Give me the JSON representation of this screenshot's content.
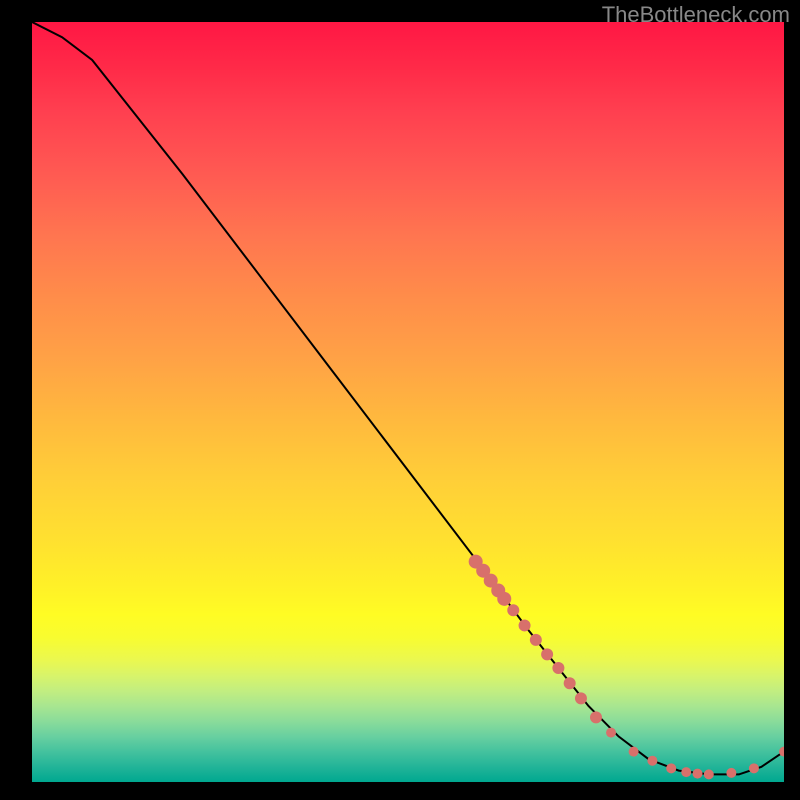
{
  "attribution": "TheBottleneck.com",
  "chart_data": {
    "type": "line",
    "title": "",
    "xlabel": "",
    "ylabel": "",
    "xlim": [
      0,
      100
    ],
    "ylim": [
      0,
      100
    ],
    "background_gradient": {
      "orientation": "vertical",
      "stops": [
        {
          "pos": 0,
          "color": "#ff1744"
        },
        {
          "pos": 50,
          "color": "#ffc040"
        },
        {
          "pos": 78,
          "color": "#fffc24"
        },
        {
          "pos": 100,
          "color": "#00a890"
        }
      ]
    },
    "series": [
      {
        "name": "curve",
        "stroke": "#000000",
        "x": [
          0,
          4,
          8,
          12,
          20,
          30,
          40,
          50,
          60,
          66,
          70,
          74,
          78,
          82,
          86,
          90,
          94,
          97,
          100
        ],
        "y": [
          100,
          98,
          95,
          90,
          80,
          67,
          54,
          41,
          28,
          20,
          15,
          10,
          6,
          3,
          1.5,
          1,
          1,
          2,
          4
        ]
      }
    ],
    "markers": {
      "color": "#d8706b",
      "points": [
        {
          "x": 59,
          "y": 29,
          "r": 7
        },
        {
          "x": 60,
          "y": 27.8,
          "r": 7
        },
        {
          "x": 61,
          "y": 26.5,
          "r": 7
        },
        {
          "x": 62,
          "y": 25.2,
          "r": 7
        },
        {
          "x": 62.8,
          "y": 24.1,
          "r": 7
        },
        {
          "x": 64,
          "y": 22.6,
          "r": 6
        },
        {
          "x": 65.5,
          "y": 20.6,
          "r": 6
        },
        {
          "x": 67,
          "y": 18.7,
          "r": 6
        },
        {
          "x": 68.5,
          "y": 16.8,
          "r": 6
        },
        {
          "x": 70,
          "y": 15,
          "r": 6
        },
        {
          "x": 71.5,
          "y": 13,
          "r": 6
        },
        {
          "x": 73,
          "y": 11,
          "r": 6
        },
        {
          "x": 75,
          "y": 8.5,
          "r": 6
        },
        {
          "x": 77,
          "y": 6.5,
          "r": 5
        },
        {
          "x": 80,
          "y": 4,
          "r": 5
        },
        {
          "x": 82.5,
          "y": 2.8,
          "r": 5
        },
        {
          "x": 85,
          "y": 1.8,
          "r": 5
        },
        {
          "x": 87,
          "y": 1.3,
          "r": 5
        },
        {
          "x": 88.5,
          "y": 1.1,
          "r": 5
        },
        {
          "x": 90,
          "y": 1,
          "r": 5
        },
        {
          "x": 93,
          "y": 1.2,
          "r": 5
        },
        {
          "x": 96,
          "y": 1.8,
          "r": 5
        },
        {
          "x": 100,
          "y": 4,
          "r": 5
        }
      ]
    }
  }
}
